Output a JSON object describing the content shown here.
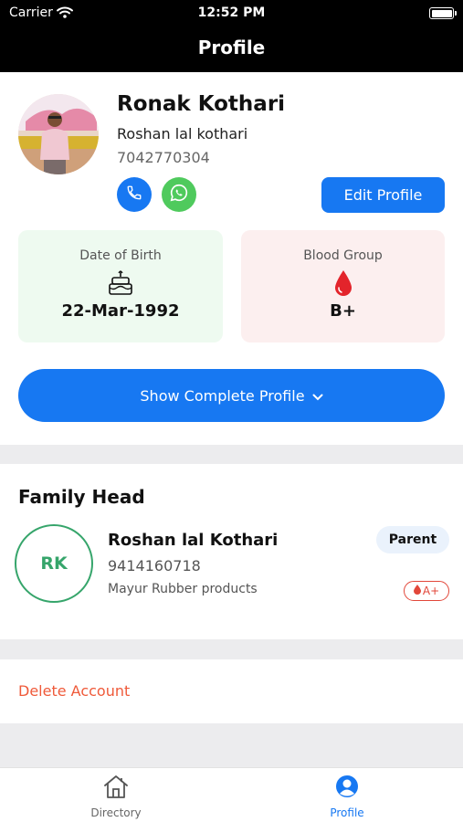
{
  "status_bar": {
    "carrier": "Carrier",
    "time": "12:52 PM"
  },
  "nav": {
    "title": "Profile"
  },
  "profile": {
    "name": "Ronak Kothari",
    "father_name": "Roshan lal kothari",
    "phone": "7042770304",
    "edit_label": "Edit Profile",
    "dob_label": "Date of Birth",
    "dob_value": "22-Mar-1992",
    "blood_label": "Blood Group",
    "blood_value": "B+",
    "show_complete_label": "Show Complete Profile"
  },
  "family_head": {
    "section_title": "Family Head",
    "initials": "RK",
    "name": "Roshan lal Kothari",
    "phone": "9414160718",
    "company": "Mayur Rubber products",
    "relation_badge": "Parent",
    "blood_group": "A+"
  },
  "account": {
    "delete_label": "Delete Account"
  },
  "tabs": [
    {
      "label": "Directory",
      "icon": "home-icon",
      "active": false
    },
    {
      "label": "Profile",
      "icon": "user-circle-icon",
      "active": true
    }
  ],
  "colors": {
    "accent": "#1778f2",
    "whatsapp": "#4fca5d",
    "danger": "#ef5a3a",
    "success": "#36a56b"
  }
}
